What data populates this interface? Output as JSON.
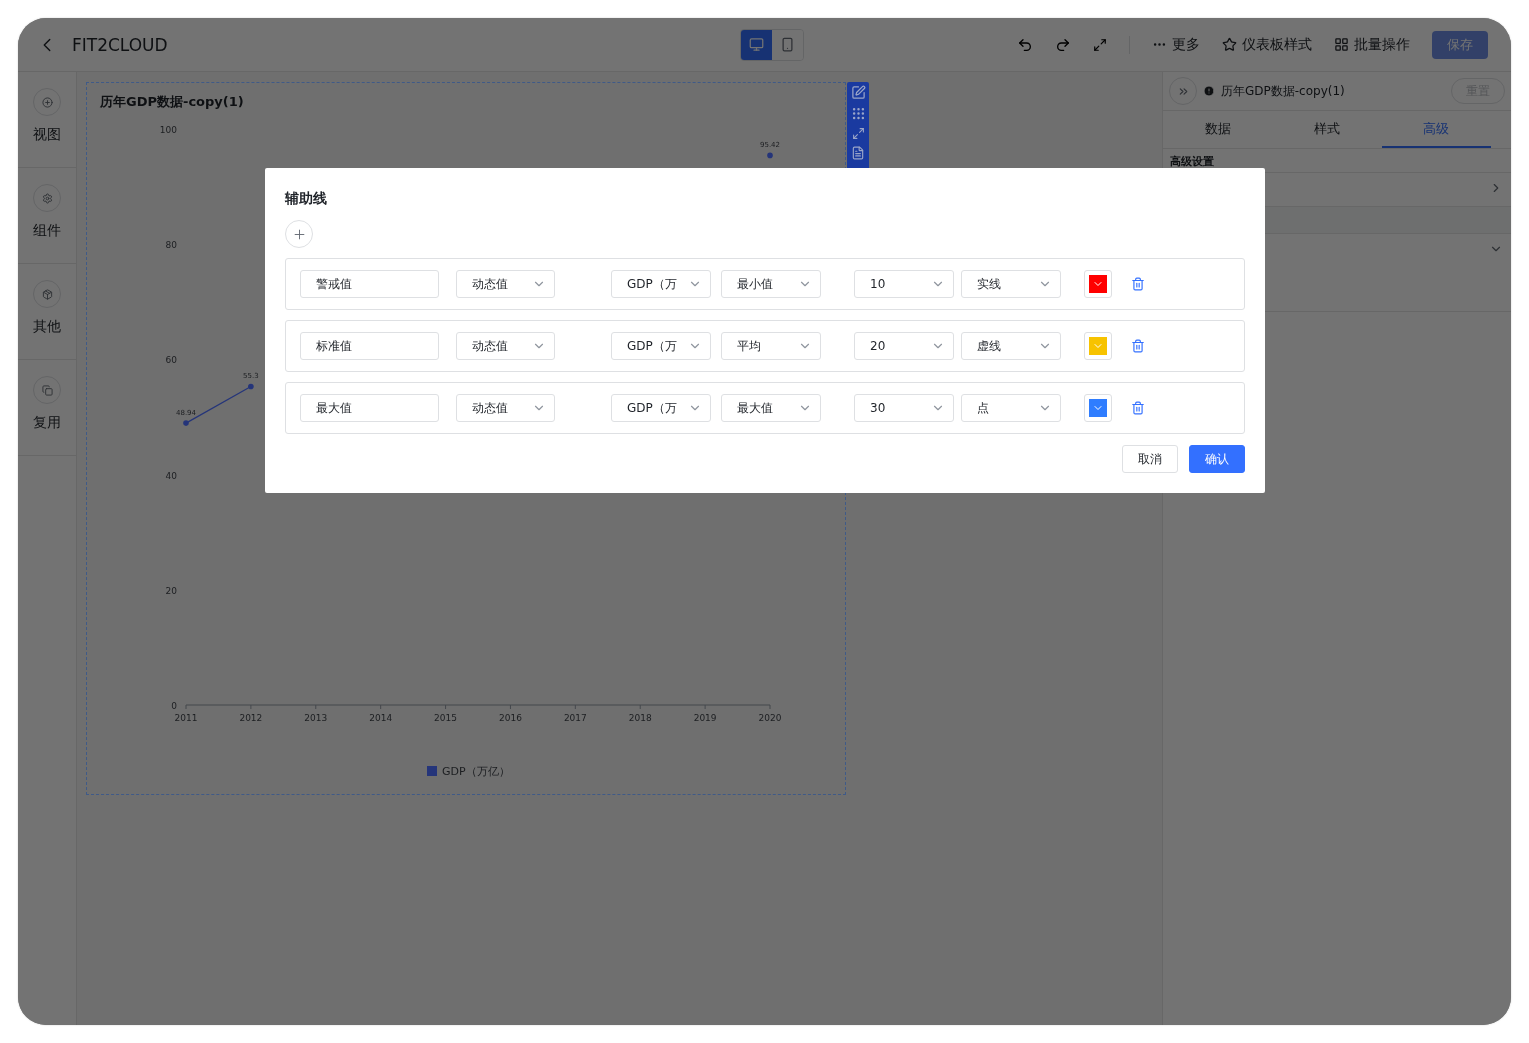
{
  "header": {
    "title": "FIT2CLOUD",
    "device_modes": [
      {
        "kind": "desktop",
        "selected": true
      },
      {
        "kind": "mobile",
        "selected": false
      }
    ],
    "actions": [
      {
        "kind": "more",
        "label": "更多"
      },
      {
        "kind": "style",
        "label": "仪表板样式"
      },
      {
        "kind": "batch",
        "label": "批量操作"
      }
    ],
    "save": {
      "label": "保存",
      "disabled": true
    }
  },
  "sidebar": {
    "items": [
      {
        "kind": "view",
        "label": "视图"
      },
      {
        "kind": "component",
        "label": "组件"
      },
      {
        "kind": "other",
        "label": "其他"
      },
      {
        "kind": "reuse",
        "label": "复用"
      }
    ]
  },
  "chart_card": {
    "title": "历年GDP数据-copy(1)",
    "chart_data": {
      "type": "line",
      "categories": [
        "2011",
        "2012",
        "2013",
        "2014",
        "2015",
        "2016",
        "2017",
        "2018",
        "2019",
        "2020"
      ],
      "series": [
        {
          "name": "GDP（万亿）",
          "color": "#25357a",
          "values": [
            48.94,
            55.3,
            null,
            null,
            null,
            null,
            null,
            null,
            null,
            95.42
          ]
        }
      ],
      "ylim": [
        0,
        100
      ],
      "yticks": [
        0,
        20,
        40,
        60,
        80,
        100
      ],
      "data_labels": true
    }
  },
  "side_panel": {
    "title": "历年GDP数据-copy(1)",
    "reset": "重置",
    "tabs": [
      {
        "label": "数据",
        "selected": false
      },
      {
        "label": "样式",
        "selected": false
      },
      {
        "label": "高级",
        "selected": true
      }
    ],
    "section": "高级设置"
  },
  "dialog": {
    "title": "辅助线",
    "lines": [
      {
        "name": "警戒值",
        "type": "动态值",
        "field": "GDP（万",
        "aggregate": "最小值",
        "size": "10",
        "style": "实线",
        "color": "#ff0000"
      },
      {
        "name": "标准值",
        "type": "动态值",
        "field": "GDP（万",
        "aggregate": "平均",
        "size": "20",
        "style": "虚线",
        "color": "#f7c300"
      },
      {
        "name": "最大值",
        "type": "动态值",
        "field": "GDP（万",
        "aggregate": "最大值",
        "size": "30",
        "style": "点",
        "color": "#2f7dff"
      }
    ],
    "cancel": "取消",
    "confirm": "确认"
  }
}
